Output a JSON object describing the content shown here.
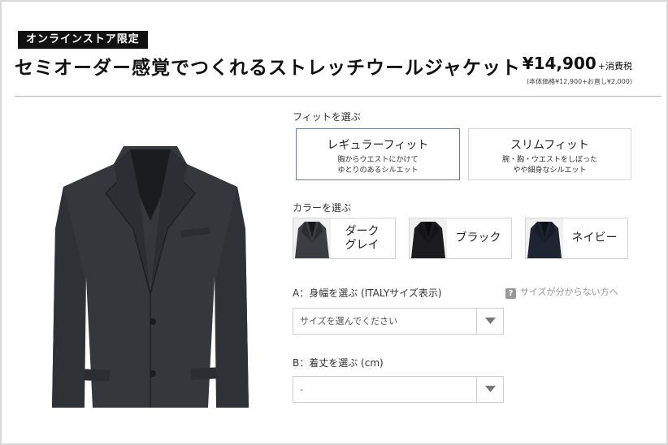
{
  "header": {
    "badge": "オンラインストア限定",
    "title": "セミオーダー感覚でつくれるストレッチウールジャケット",
    "price": "¥14,900",
    "price_tax": "+消費税",
    "price_note": "(本体価格¥12,900+お直し¥2,000)"
  },
  "fit": {
    "label": "フィットを選ぶ",
    "options": [
      {
        "title": "レギュラーフィット",
        "desc": "胸からウエストにかけて\nゆとりのあるシルエット",
        "selected": true
      },
      {
        "title": "スリムフィット",
        "desc": "腕・胸・ウエストをしぼった\nやや細身なシルエット",
        "selected": false
      }
    ]
  },
  "color": {
    "label": "カラーを選ぶ",
    "options": [
      {
        "name": "ダーク\nグレイ",
        "swatch": "#3a3d42"
      },
      {
        "name": "ブラック",
        "swatch": "#1c1c1e"
      },
      {
        "name": "ネイビー",
        "swatch": "#1f2433"
      }
    ]
  },
  "size_a": {
    "label": "A：身幅を選ぶ (ITALYサイズ表示)",
    "help": "サイズが分からない方へ",
    "help_icon": "?",
    "value": "サイズを選んでください"
  },
  "size_b": {
    "label": "B：着丈を選ぶ (cm)",
    "value": "-"
  },
  "colors": {
    "jacket": "#33363b",
    "selected_border": "#6d7a9a"
  }
}
